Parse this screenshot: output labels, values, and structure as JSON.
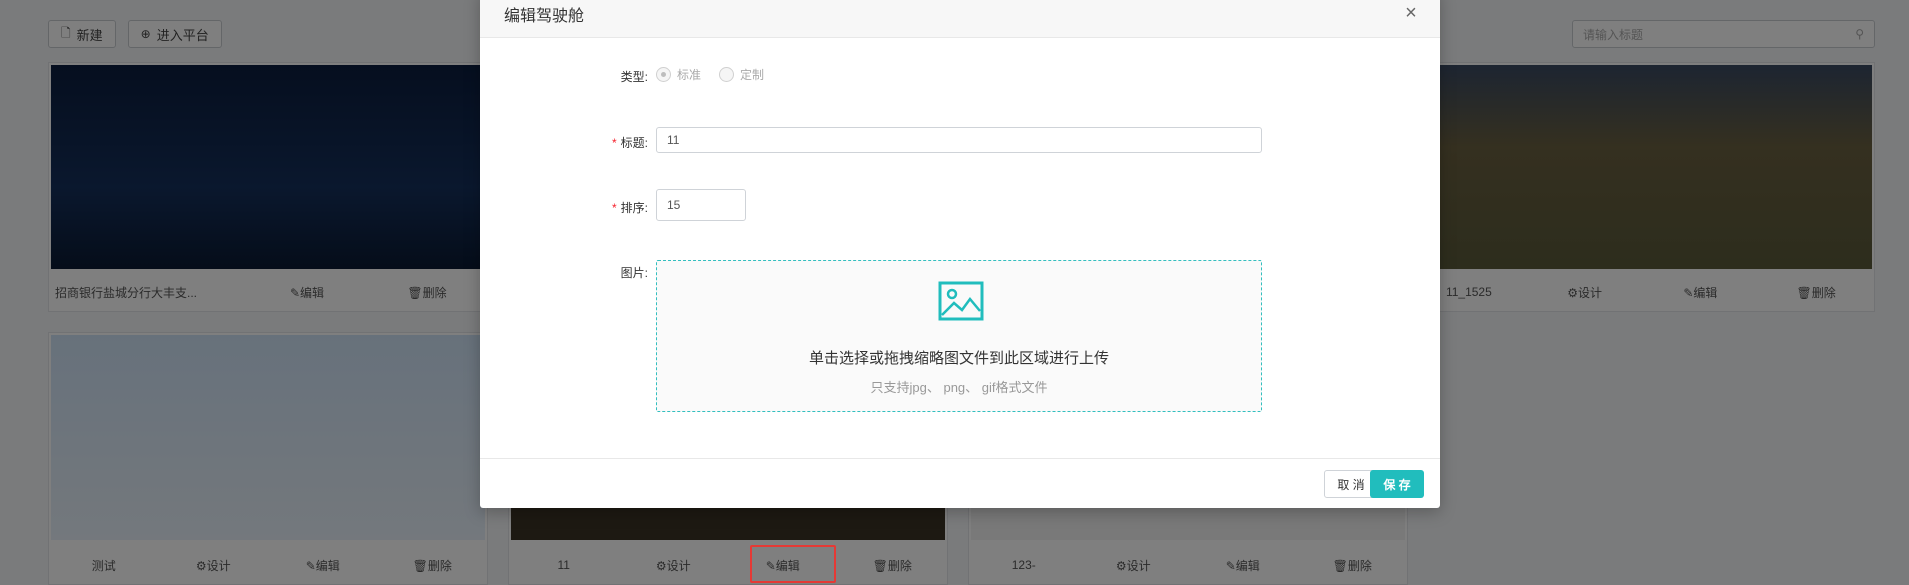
{
  "toolbar": {
    "new_label": "新建",
    "enter_label": "进入平台",
    "search_placeholder": "请输入标题"
  },
  "cards": [
    {
      "title": "招商银行盐城分行大丰支...",
      "edit": "编辑",
      "delete": "删除"
    },
    {
      "title": "11_1525",
      "design": "设计",
      "edit": "编辑",
      "delete": "删除"
    },
    {
      "title": "测试",
      "design": "设计",
      "edit": "编辑",
      "delete": "删除"
    },
    {
      "title": "11",
      "design": "设计",
      "edit": "编辑",
      "delete": "删除"
    },
    {
      "title": "123-",
      "design": "设计",
      "edit": "编辑",
      "delete": "删除"
    }
  ],
  "modal": {
    "title": "编辑驾驶舱",
    "close_icon": "×",
    "type_label": "类型:",
    "type_options": [
      "标准",
      "定制"
    ],
    "type_selected": "标准",
    "title_label": "标题:",
    "title_value": "11",
    "sort_label": "排序:",
    "sort_value": "15",
    "image_label": "图片:",
    "upload_text": "单击选择或拖拽缩略图文件到此区域进行上传",
    "upload_hint": "只支持jpg、 png、 gif格式文件",
    "cancel_label": "取 消",
    "save_label": "保 存"
  },
  "colors": {
    "accent": "#21bdbd",
    "required": "#f5222d",
    "highlight": "#e53935"
  }
}
